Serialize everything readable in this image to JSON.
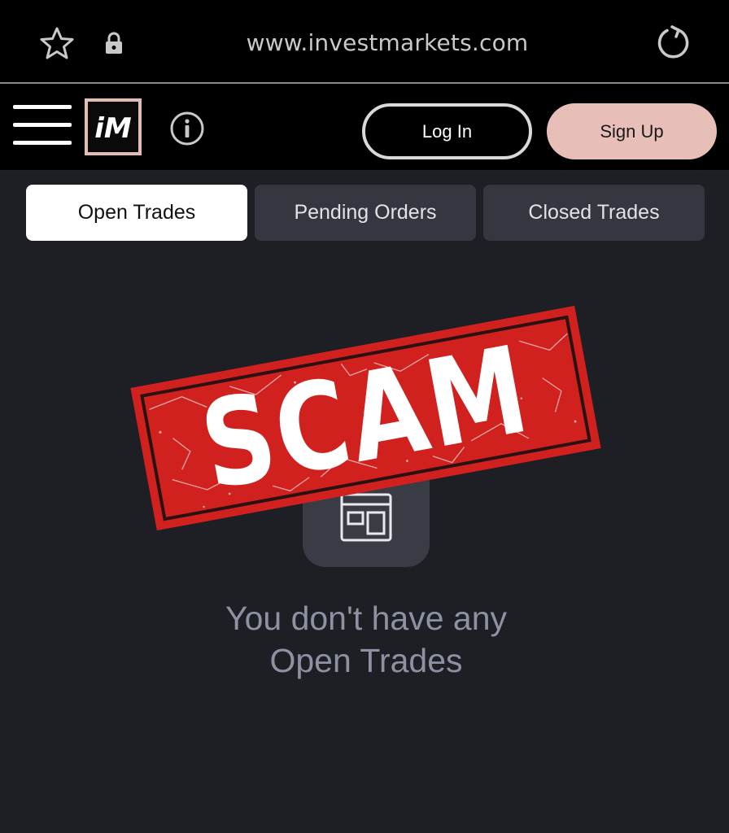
{
  "browser": {
    "url": "www.investmarkets.com",
    "icons": [
      "star-icon",
      "lock-icon",
      "reload-icon"
    ]
  },
  "header": {
    "logo_text": "iM",
    "login_label": "Log In",
    "signup_label": "Sign Up",
    "icons": [
      "menu-icon",
      "info-icon"
    ]
  },
  "tabs": [
    {
      "label": "Open Trades",
      "active": true
    },
    {
      "label": "Pending Orders",
      "active": false
    },
    {
      "label": "Closed Trades",
      "active": false
    }
  ],
  "empty_state": {
    "line1": "You don't have any",
    "line2": "Open Trades",
    "icon": "empty-box-icon"
  },
  "stamp": {
    "text": "SCAM"
  },
  "colors": {
    "page_bg": "#1e1f24",
    "header_bg": "#000000",
    "signup_bg": "#e7beb8",
    "tab_active_bg": "#ffffff",
    "tab_inactive_bg": "#353740",
    "stamp_red": "#d0211f",
    "empty_text": "#8d92a3"
  }
}
